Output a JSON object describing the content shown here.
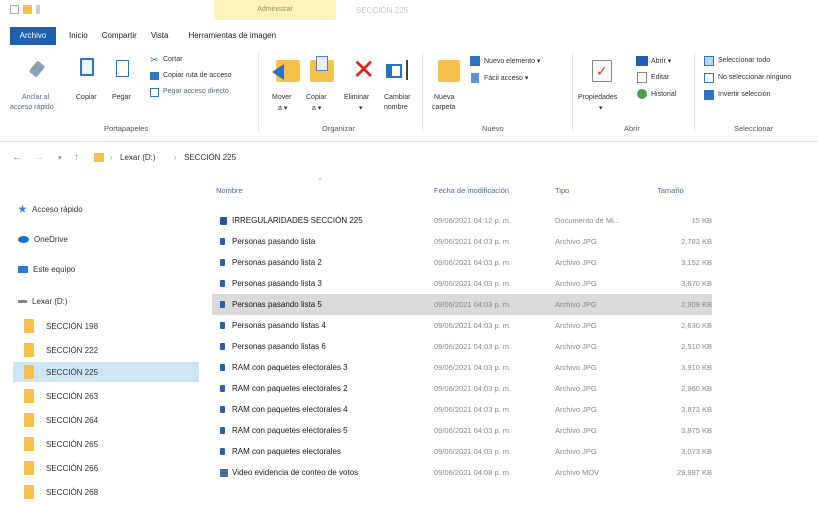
{
  "window": {
    "title": "SECCIÓN 225",
    "contextual_tab": "Administrar"
  },
  "ribbon_tabs": [
    "Archivo",
    "Inicio",
    "Compartir",
    "Vista",
    "Herramientas de imagen"
  ],
  "ribbon": {
    "portapapeles": {
      "pin_label_1": "Anclar al",
      "pin_label_2": "acceso rápido",
      "copy": "Copiar",
      "paste": "Pegar",
      "cut": "Cortar",
      "copy_path": "Copiar ruta de acceso",
      "paste_shortcut": "Pegar acceso directo",
      "group": "Portapapeles"
    },
    "organizar": {
      "move_1": "Mover",
      "move_2": "a ▾",
      "copy_1": "Copiar",
      "copy_2": "a ▾",
      "delete_1": "Eliminar",
      "delete_2": "▾",
      "rename_1": "Cambiar",
      "rename_2": "nombre",
      "group": "Organizar"
    },
    "nuevo": {
      "new_folder_1": "Nueva",
      "new_folder_2": "carpeta",
      "new_item": "Nuevo elemento ▾",
      "easy_access": "Fácil acceso ▾",
      "group": "Nuevo"
    },
    "abrir": {
      "properties_1": "Propiedades",
      "properties_2": "▾",
      "open": "Abrir ▾",
      "edit": "Editar",
      "history": "Historial",
      "group": "Abrir"
    },
    "seleccionar": {
      "select_all": "Seleccionar todo",
      "select_none": "No seleccionar ninguno",
      "invert": "Invertir selección",
      "group": "Seleccionar"
    }
  },
  "address": {
    "back": "←",
    "forward": "→",
    "recent": "▾",
    "up": "↑",
    "crumbs": [
      "Lexar (D:)",
      "SECCIÓN 225"
    ],
    "sep": "›"
  },
  "nav": {
    "quick_access": "Acceso rápido",
    "onedrive": "OneDrive",
    "this_pc": "Este equipo",
    "drive": "Lexar (D:)",
    "folders": [
      "SECCIÓN 198",
      "SECCIÓN 222",
      "SECCIÓN 225",
      "SECCIÓN 263",
      "SECCIÓN 264",
      "SECCIÓN 265",
      "SECCIÓN 266",
      "SECCIÓN 268"
    ],
    "selected_folder": "SECCIÓN 225"
  },
  "columns": {
    "name": "Nombre",
    "date": "Fecha de modificación",
    "type": "Tipo",
    "size": "Tamaño"
  },
  "files": [
    {
      "name": "IRREGULARIDADES SECCIÓN 225",
      "date": "09/06/2021 04:12 p. m.",
      "type": "Documento de Mi...",
      "size": "15 KB",
      "icon": "word-icon"
    },
    {
      "name": "Personas pasando lista",
      "date": "09/06/2021 04:03 p. m.",
      "type": "Archivo JPG",
      "size": "2,783 KB",
      "icon": "jpg-icon"
    },
    {
      "name": "Personas pasando lista 2",
      "date": "09/06/2021 04:03 p. m.",
      "type": "Archivo JPG",
      "size": "3,152 KB",
      "icon": "jpg-icon"
    },
    {
      "name": "Personas pasando lista 3",
      "date": "09/06/2021 04:03 p. m.",
      "type": "Archivo JPG",
      "size": "3,670 KB",
      "icon": "jpg-icon"
    },
    {
      "name": "Personas pasando lista 5",
      "date": "09/06/2021 04:03 p. m.",
      "type": "Archivo JPG",
      "size": "2,909 KB",
      "icon": "jpg-icon"
    },
    {
      "name": "Personas pasando listas 4",
      "date": "09/06/2021 04:03 p. m.",
      "type": "Archivo JPG",
      "size": "2,630 KB",
      "icon": "jpg-icon"
    },
    {
      "name": "Personas pasando listas 6",
      "date": "09/06/2021 04:03 p. m.",
      "type": "Archivo JPG",
      "size": "2,510 KB",
      "icon": "jpg-icon"
    },
    {
      "name": "RAM con paquetes electorales 3",
      "date": "09/06/2021 04:03 p. m.",
      "type": "Archivo JPG",
      "size": "3,910 KB",
      "icon": "jpg-icon"
    },
    {
      "name": "RAM con paquetes electorales 2",
      "date": "09/06/2021 04:03 p. m.",
      "type": "Archivo JPG",
      "size": "2,960 KB",
      "icon": "jpg-icon"
    },
    {
      "name": "RAM con paquetes electorales 4",
      "date": "09/06/2021 04:03 p. m.",
      "type": "Archivo JPG",
      "size": "3,873 KB",
      "icon": "jpg-icon"
    },
    {
      "name": "RAM con paquetes electorales 5",
      "date": "09/06/2021 04:03 p. m.",
      "type": "Archivo JPG",
      "size": "3,875 KB",
      "icon": "jpg-icon"
    },
    {
      "name": "RAM con paquetes electorales",
      "date": "09/06/2021 04:03 p. m.",
      "type": "Archivo JPG",
      "size": "3,073 KB",
      "icon": "jpg-icon"
    },
    {
      "name": "Video evidencia de conteo de votos",
      "date": "09/06/2021 04:08 p. m.",
      "type": "Archivo MOV",
      "size": "29,987 KB",
      "icon": "mov-icon"
    }
  ],
  "selected_file": "Personas pasando lista 5",
  "colors": {
    "accent": "#1f5fb0",
    "folder": "#f6c04a",
    "selection": "#cde6f7",
    "row_selection": "#dadada"
  }
}
